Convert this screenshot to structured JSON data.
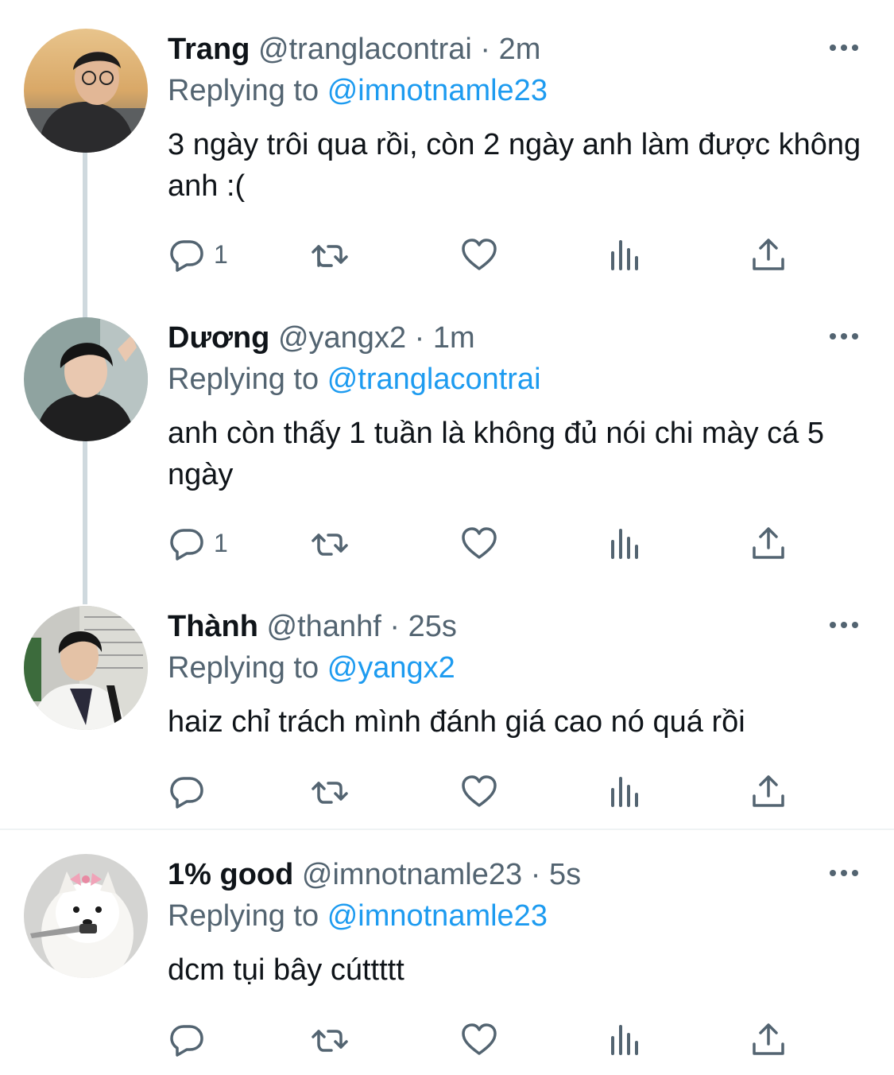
{
  "tweets": [
    {
      "name": "Trang",
      "handle": "@tranglacontrai",
      "separator": "·",
      "time": "2m",
      "replying_prefix": "Replying to",
      "replying_to": "@imnotnamle23",
      "text": "3 ngày trôi qua rồi, còn 2 ngày anh làm được không anh :(",
      "reply_count": "1"
    },
    {
      "name": "Dương",
      "handle": "@yangx2",
      "separator": "·",
      "time": "1m",
      "replying_prefix": "Replying to",
      "replying_to": "@tranglacontrai",
      "text": "anh còn thấy 1 tuần là không đủ nói chi mày cá 5 ngày",
      "reply_count": "1"
    },
    {
      "name": "Thành",
      "handle": "@thanhf",
      "separator": "·",
      "time": "25s",
      "replying_prefix": "Replying to",
      "replying_to": "@yangx2",
      "text": "haiz chỉ trách mình đánh giá cao nó quá rồi",
      "reply_count": ""
    },
    {
      "name": "1% good",
      "handle": "@imnotnamle23",
      "separator": "·",
      "time": "5s",
      "replying_prefix": "Replying to",
      "replying_to": "@imnotnamle23",
      "text": "dcm tụi bây cúttttt",
      "reply_count": ""
    }
  ],
  "icons": {
    "more": "more-dots-icon",
    "reply": "reply-bubble-icon",
    "retweet": "retweet-icon",
    "like": "heart-icon",
    "views": "views-bar-chart-icon",
    "share": "share-upload-icon"
  },
  "colors": {
    "link": "#1d9bf0",
    "secondary_text": "#536471",
    "primary_text": "#0f1419",
    "thread_line": "#cfd9de",
    "divider": "#eff3f4"
  }
}
